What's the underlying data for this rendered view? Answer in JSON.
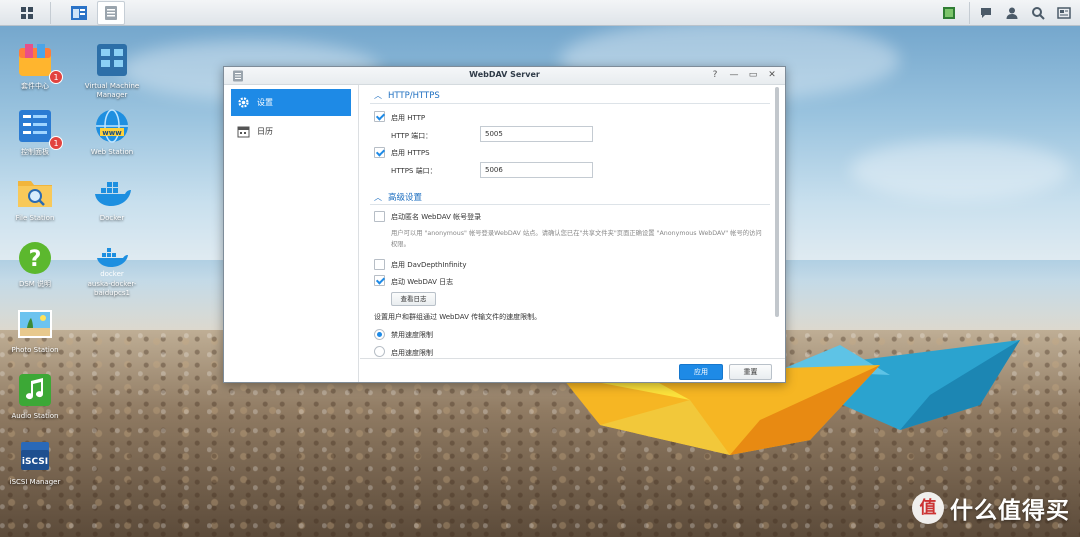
{
  "desktop": {
    "icons": [
      {
        "label": "套件中心",
        "badge": "1"
      },
      {
        "label": "Virtual Machine Manager",
        "badge": ""
      },
      {
        "label": "控制面板",
        "badge": "1"
      },
      {
        "label": "Web Station",
        "badge": ""
      },
      {
        "label": "File Station",
        "badge": ""
      },
      {
        "label": "Docker",
        "badge": ""
      },
      {
        "label": "DSM 说明",
        "badge": ""
      },
      {
        "label": "auska-docker-baidupcs1",
        "badge": ""
      },
      {
        "label": "Photo Station",
        "badge": ""
      },
      {
        "label": "Audio Station",
        "badge": ""
      },
      {
        "label": "iSCSI Manager",
        "badge": ""
      }
    ]
  },
  "window": {
    "title": "WebDAV Server",
    "controls": {
      "help": "?",
      "minimize": "—",
      "maximize": "▭",
      "close": "✕"
    },
    "sidebar": {
      "items": [
        {
          "label": "设置",
          "icon": "gear-icon",
          "active": true
        },
        {
          "label": "日历",
          "icon": "calendar-icon",
          "active": false
        }
      ]
    },
    "http_section": {
      "title": "HTTP/HTTPS",
      "enable_http": {
        "label": "启用 HTTP",
        "checked": true
      },
      "http_port": {
        "label": "HTTP 端口：",
        "value": "5005"
      },
      "enable_https": {
        "label": "启用 HTTPS",
        "checked": true
      },
      "https_port": {
        "label": "HTTPS 端口：",
        "value": "5006"
      }
    },
    "advanced_section": {
      "title": "高级设置",
      "anonymous": {
        "label": "启动匿名 WebDAV 帐号登录",
        "checked": false
      },
      "anonymous_help": "用户可以用 \"anonymous\" 帐号登录WebDAV 站点。请确认您已在\"共享文件夹\"页面正确设置 \"Anonymous WebDAV\" 帐号的访问权限。",
      "depth_infinity": {
        "label": "启用 DavDepthInfinity",
        "checked": false
      },
      "log": {
        "label": "启动 WebDAV 日志",
        "checked": true
      },
      "view_log_button": "查看日志",
      "speed_limit_desc": "设置用户和群组通过 WebDAV 传输文件的速度限制。",
      "speed_options": [
        {
          "label": "禁用速度限制",
          "selected": true
        },
        {
          "label": "启用速度限制",
          "selected": false
        }
      ]
    },
    "footer": {
      "apply": "应用",
      "reset": "重置"
    }
  },
  "watermark": {
    "text": "什么值得买",
    "logo": "值"
  },
  "colors": {
    "accent": "#1e8ae6",
    "section_title": "#1e6fc0",
    "badge": "#e2433f"
  }
}
